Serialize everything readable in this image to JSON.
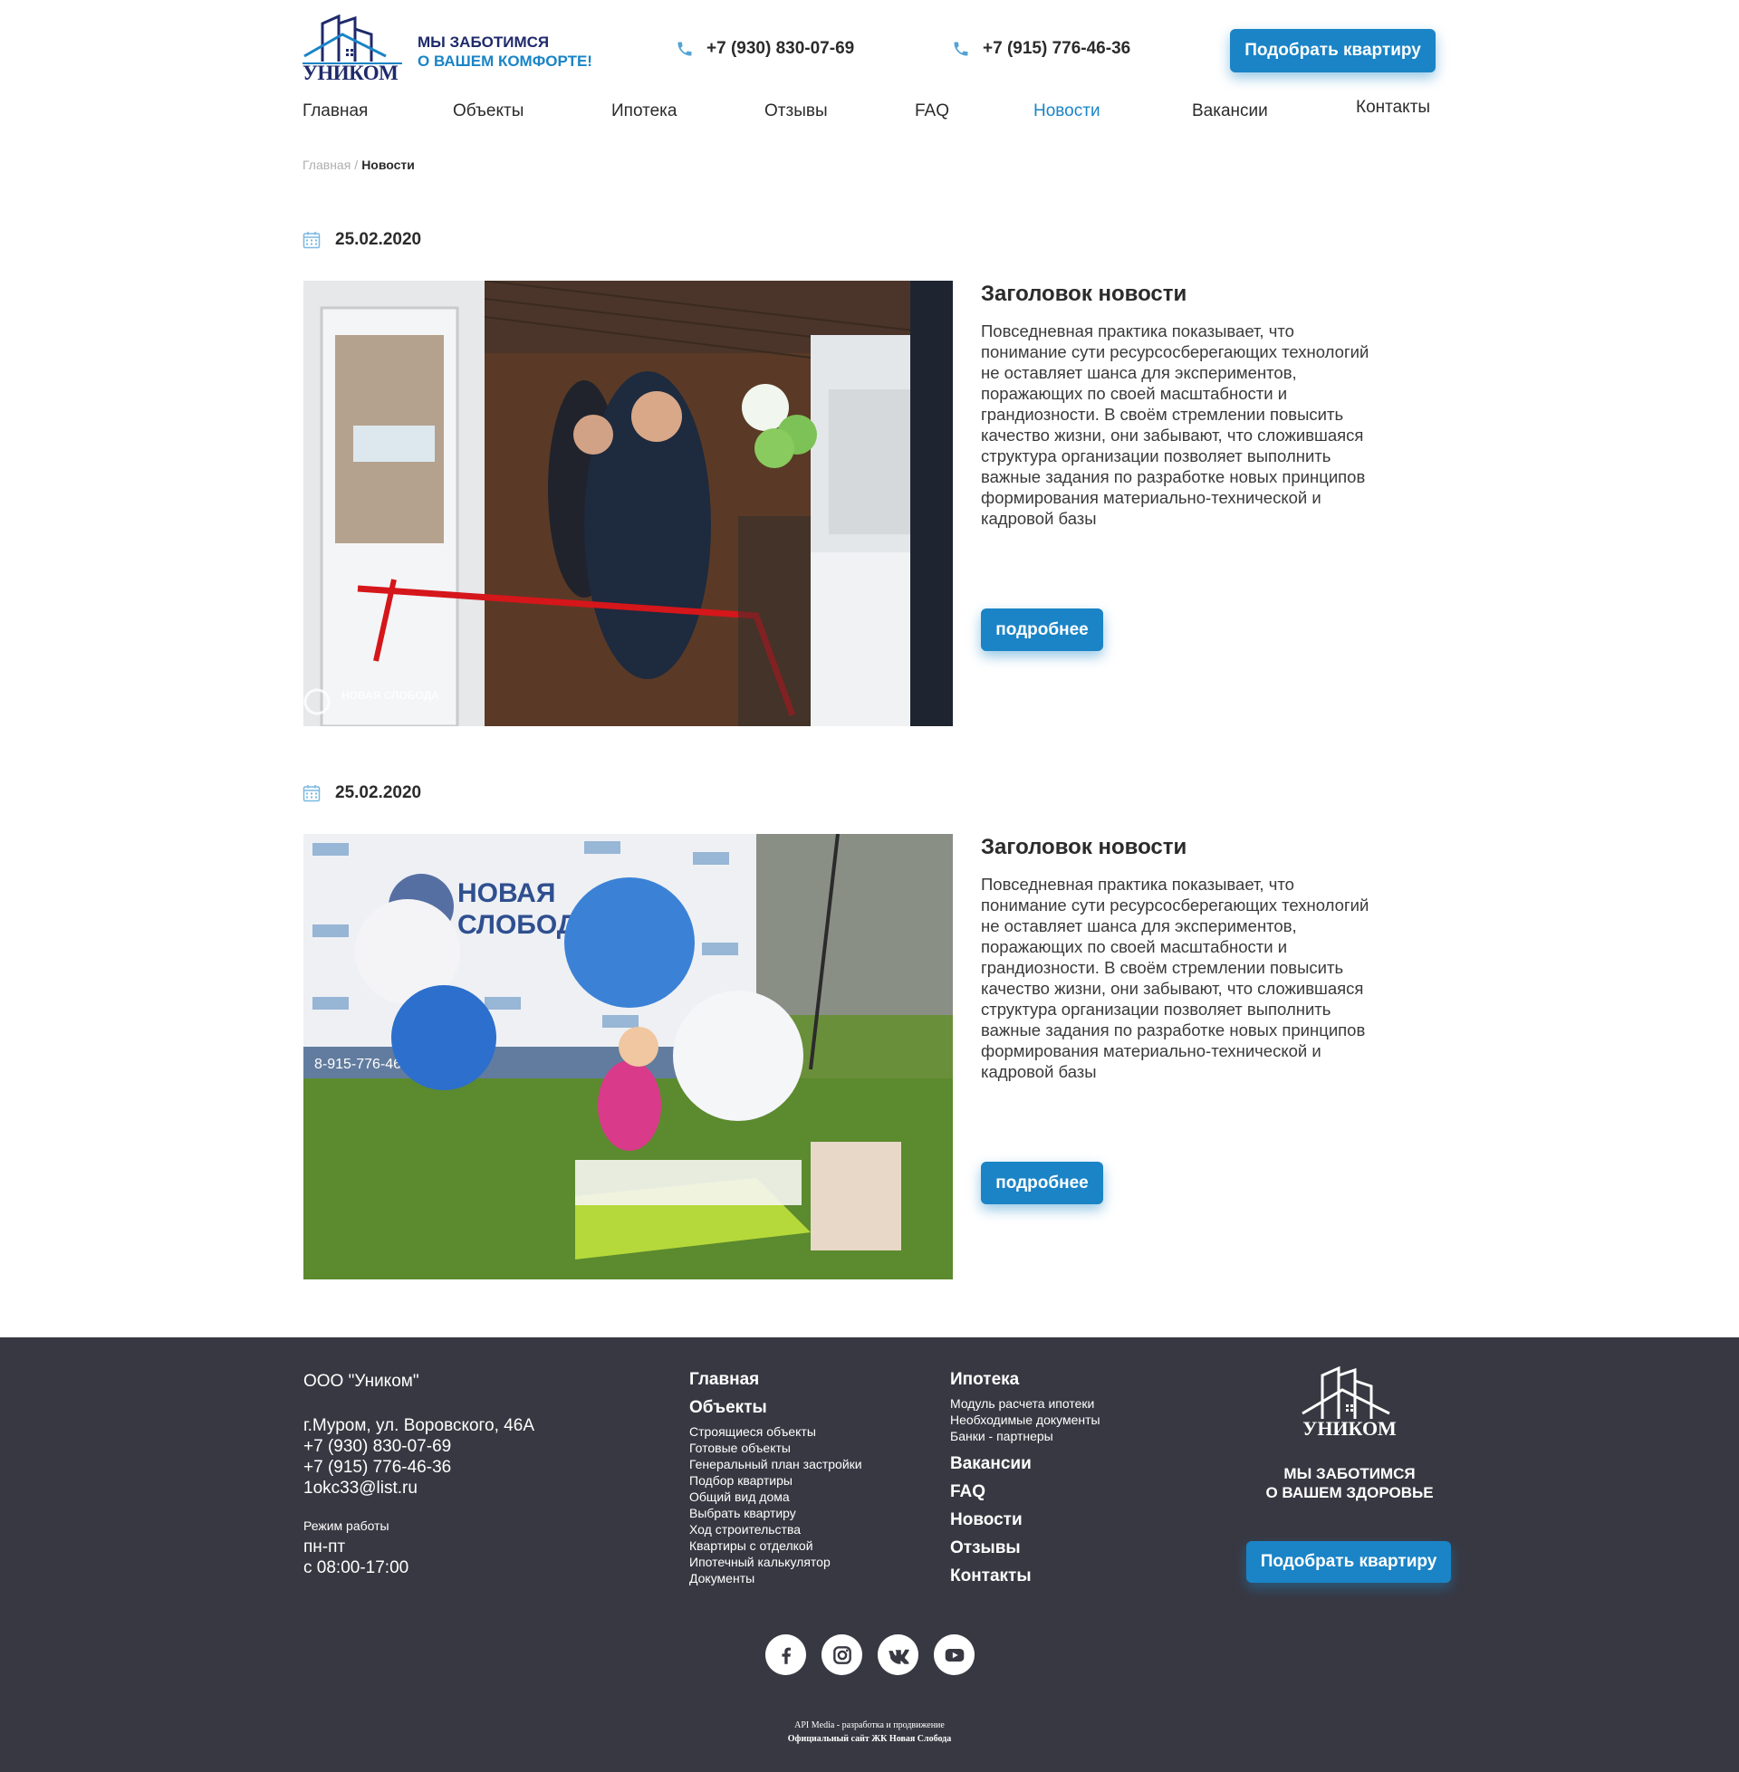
{
  "header": {
    "logo_text": "УНИКОМ",
    "tagline_line1": "МЫ ЗАБОТИМСЯ",
    "tagline_line2": "О ВАШЕМ КОМФОРТЕ!",
    "phone1": "+7 (930) 830-07-69",
    "phone2": "+7 (915) 776-46-36",
    "cta_label": "Подобрать квартиру",
    "phone_icon": "phone-icon"
  },
  "nav": {
    "items": [
      {
        "label": "Главная"
      },
      {
        "label": "Объекты"
      },
      {
        "label": "Ипотека"
      },
      {
        "label": "Отзывы"
      },
      {
        "label": "FAQ"
      },
      {
        "label": "Новости"
      },
      {
        "label": "Вакансии"
      },
      {
        "label": "Контакты"
      }
    ],
    "active": "Новости"
  },
  "breadcrumb": {
    "home": "Главная",
    "separator": "/",
    "current": "Новости"
  },
  "news": [
    {
      "date": "25.02.2020",
      "title": "Заголовок новости",
      "text": "Повседневная практика показывает, что понимание сути ресурсосберегающих технологий не оставляет шанса для экспериментов, поражающих по своей масштабности и грандиозности. В своём стремлении повысить качество жизни, они забывают, что сложившаяся структура организации позволяет выполнить важные задания по разработке новых принципов формирования материально-технической и кадровой базы",
      "more_label": "подробнее",
      "image_caption": "НОВАЯ СЛОБОДА"
    },
    {
      "date": "25.02.2020",
      "title": "Заголовок новости",
      "text": "Повседневная практика показывает, что понимание сути ресурсосберегающих технологий не оставляет шанса для экспериментов, поражающих по своей масштабности и грандиозности. В своём стремлении повысить качество жизни, они забывают, что сложившаяся структура организации позволяет выполнить важные задания по разработке новых принципов формирования материально-технической и кадровой базы",
      "more_label": "подробнее",
      "banner_title_line1": "НОВАЯ",
      "banner_title_line2": "СЛОБОДА",
      "banner_phone": "8-915-776-46"
    }
  ],
  "footer": {
    "company": "ООО \"Уником\"",
    "address": "г.Муром, ул. Воровского, 46А",
    "phone1": "+7 (930) 830-07-69",
    "phone2": "+7 (915) 776-46-36",
    "email": "1okc33@list.ru",
    "hours_label": "Режим работы",
    "hours_days": "пн-пт",
    "hours_time": "с 08:00-17:00",
    "col2": {
      "main1": "Главная",
      "main2": "Объекты",
      "sub": [
        "Строящиеся объекты",
        "Готовые объекты",
        "Генеральный план застройки",
        "Подбор квартиры",
        "Общий вид дома",
        "Выбрать квартиру",
        "Ход строительства",
        "Квартиры с отделкой",
        "Ипотечный калькулятор",
        "Документы"
      ]
    },
    "col3": {
      "main1": "Ипотека",
      "sub": [
        "Модуль расчета ипотеки",
        "Необходимые документы",
        "Банки - партнеры"
      ],
      "rest": [
        "Вакансии",
        "FAQ",
        "Новости",
        "Отзывы",
        "Контакты"
      ]
    },
    "logo_text": "УНИКОМ",
    "slogan_line1": "МЫ ЗАБОТИМСЯ",
    "slogan_line2": "О ВАШЕМ ЗДОРОВЬЕ",
    "cta_label": "Подобрать квартиру",
    "socials": [
      "facebook-icon",
      "instagram-icon",
      "vk-icon",
      "youtube-icon"
    ],
    "credit1": "API Media - разработка и продвижение",
    "credit2": "Официальный сайт ЖК Новая Слобода"
  },
  "colors": {
    "accent": "#1a84c6",
    "brand_dark": "#1f2a6b",
    "footer_bg": "#383842"
  }
}
